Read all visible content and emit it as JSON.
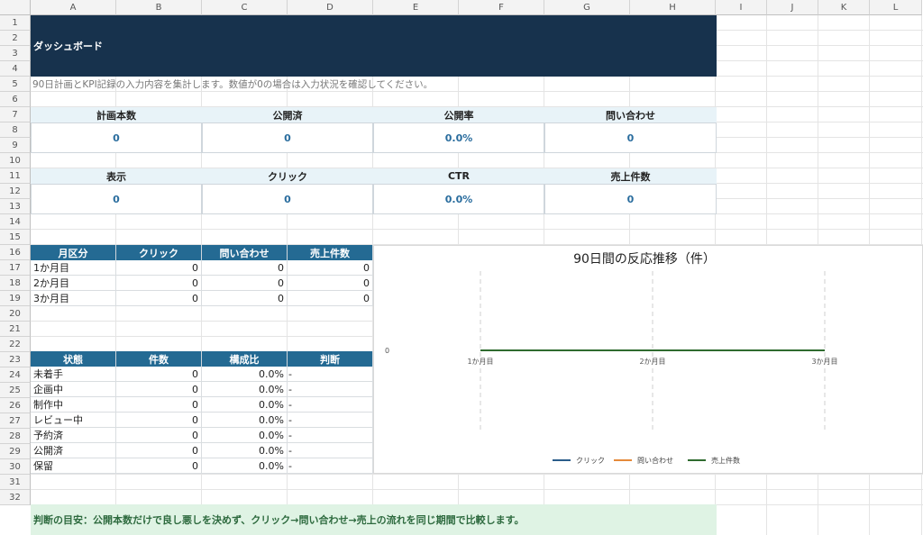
{
  "columns": [
    "A",
    "B",
    "C",
    "D",
    "E",
    "F",
    "G",
    "H",
    "I",
    "J",
    "K",
    "L"
  ],
  "rows": [
    "1",
    "2",
    "3",
    "4",
    "5",
    "6",
    "7",
    "8",
    "9",
    "10",
    "11",
    "12",
    "13",
    "14",
    "15",
    "16",
    "17",
    "18",
    "19",
    "20",
    "21",
    "22",
    "23",
    "24",
    "25",
    "26",
    "27",
    "28",
    "29",
    "30",
    "31",
    "32"
  ],
  "dashboard": {
    "title": "ダッシュボード",
    "subtitle": "90日計画とKPI記録の入力内容を集計します。数値が0の場合は入力状況を確認してください。",
    "kpi_row1": [
      {
        "label": "計画本数",
        "value": "0"
      },
      {
        "label": "公開済",
        "value": "0"
      },
      {
        "label": "公開率",
        "value": "0.0%"
      },
      {
        "label": "問い合わせ",
        "value": "0"
      }
    ],
    "kpi_row2": [
      {
        "label": "表示",
        "value": "0"
      },
      {
        "label": "クリック",
        "value": "0"
      },
      {
        "label": "CTR",
        "value": "0.0%"
      },
      {
        "label": "売上件数",
        "value": "0"
      }
    ]
  },
  "monthly_table": {
    "headers": [
      "月区分",
      "クリック",
      "問い合わせ",
      "売上件数"
    ],
    "rows": [
      [
        "1か月目",
        "0",
        "0",
        "0"
      ],
      [
        "2か月目",
        "0",
        "0",
        "0"
      ],
      [
        "3か月目",
        "0",
        "0",
        "0"
      ]
    ]
  },
  "status_table": {
    "headers": [
      "状態",
      "件数",
      "構成比",
      "判断"
    ],
    "rows": [
      [
        "未着手",
        "0",
        "0.0%",
        "-"
      ],
      [
        "企画中",
        "0",
        "0.0%",
        "-"
      ],
      [
        "制作中",
        "0",
        "0.0%",
        "-"
      ],
      [
        "レビュー中",
        "0",
        "0.0%",
        "-"
      ],
      [
        "予約済",
        "0",
        "0.0%",
        "-"
      ],
      [
        "公開済",
        "0",
        "0.0%",
        "-"
      ],
      [
        "保留",
        "0",
        "0.0%",
        "-"
      ]
    ]
  },
  "note": "判断の目安：公開本数だけで良し悪しを決めず、クリック→問い合わせ→売上の流れを同じ期間で比較します。",
  "chart_data": {
    "type": "line",
    "title": "90日間の反応推移（件）",
    "categories": [
      "1か月目",
      "2か月目",
      "3か月目"
    ],
    "y_tick_labels": [
      "0"
    ],
    "ylim": [
      0,
      0
    ],
    "legend_position": "bottom",
    "grid": "vertical-dashed",
    "series": [
      {
        "name": "クリック",
        "values": [
          0,
          0,
          0
        ],
        "color": "#2a5d8a"
      },
      {
        "name": "問い合わせ",
        "values": [
          0,
          0,
          0
        ],
        "color": "#e58a3a"
      },
      {
        "name": "売上件数",
        "values": [
          0,
          0,
          0
        ],
        "color": "#2f6b2f"
      }
    ]
  }
}
